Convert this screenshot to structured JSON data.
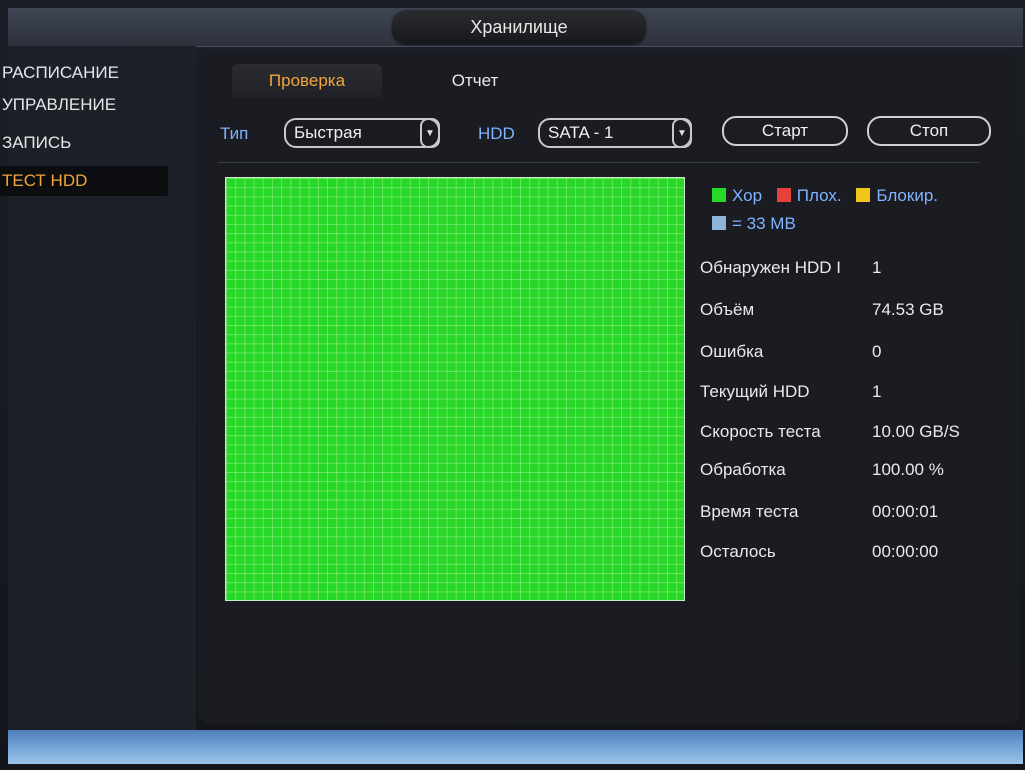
{
  "title": "Хранилище",
  "sidebar": {
    "items": [
      {
        "label": "РАСПИСАНИЕ"
      },
      {
        "label": "УПРАВЛЕНИЕ"
      },
      {
        "label": "ЗАПИСЬ"
      },
      {
        "label": "ТЕСТ HDD"
      }
    ],
    "active_index": 3
  },
  "tabs": [
    {
      "label": "Проверка",
      "active": true
    },
    {
      "label": "Отчет",
      "active": false
    }
  ],
  "controls": {
    "type_label": "Тип",
    "type_value": "Быстрая",
    "hdd_label": "HDD",
    "hdd_value": "SATA - 1",
    "start_label": "Старт",
    "stop_label": "Стоп"
  },
  "legend": {
    "good": "Хор",
    "bad": "Плох.",
    "blocked": "Блокир.",
    "block_size": "= 33 MB",
    "colors": {
      "good": "#27d828",
      "bad": "#e8403a",
      "blocked": "#f0c419",
      "block": "#8fb4d9"
    }
  },
  "info": [
    {
      "label": "Обнаружен HDD I",
      "value": "1"
    },
    {
      "label": "Объём",
      "value": "74.53 GB"
    },
    {
      "label": "Ошибка",
      "value": "0"
    },
    {
      "label": "Текущий HDD",
      "value": "1"
    },
    {
      "label": "Скорость теста",
      "value": "10.00 GB/S"
    },
    {
      "label": "Обработка",
      "value": "100.00 %"
    },
    {
      "label": "Время теста",
      "value": "00:00:01"
    },
    {
      "label": "Осталось",
      "value": "00:00:00"
    }
  ]
}
